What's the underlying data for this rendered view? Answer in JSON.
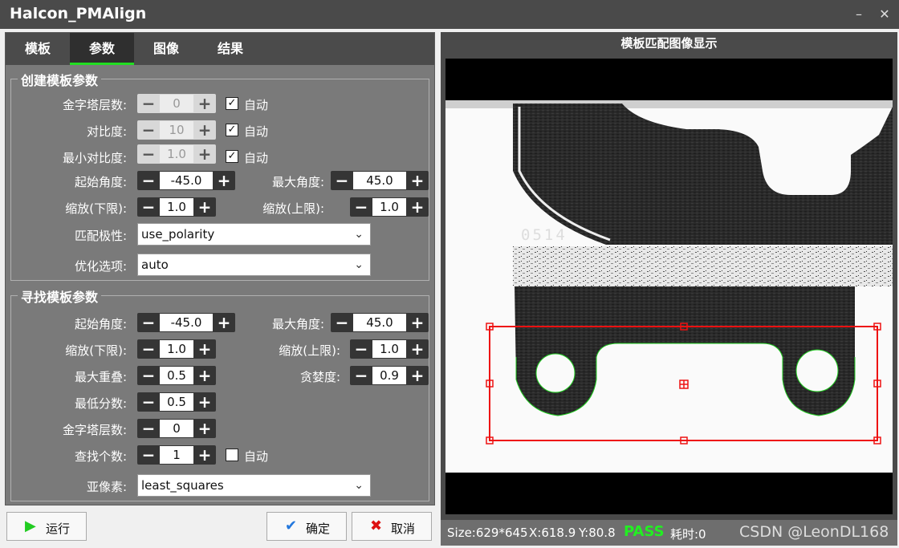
{
  "window": {
    "title": "Halcon_PMAlign",
    "minimize": "–",
    "close": "✕"
  },
  "tabs": [
    {
      "label": "模板",
      "active": false
    },
    {
      "label": "参数",
      "active": true
    },
    {
      "label": "图像",
      "active": false
    },
    {
      "label": "结果",
      "active": false
    }
  ],
  "create_group": {
    "title": "创建模板参数",
    "pyramid": {
      "label": "金字塔层数:",
      "value": "0",
      "auto_label": "自动",
      "auto": true
    },
    "contrast": {
      "label": "对比度:",
      "value": "10",
      "auto_label": "自动",
      "auto": true
    },
    "min_contrast": {
      "label": "最小对比度:",
      "value": "1.0",
      "auto_label": "自动",
      "auto": true
    },
    "start_angle": {
      "label": "起始角度:",
      "value": "-45.0"
    },
    "max_angle": {
      "label": "最大角度:",
      "value": "45.0"
    },
    "scale_min": {
      "label": "缩放(下限):",
      "value": "1.0"
    },
    "scale_max": {
      "label": "缩放(上限):",
      "value": "1.0"
    },
    "polarity": {
      "label": "匹配极性:",
      "value": "use_polarity"
    },
    "optimization": {
      "label": "优化选项:",
      "value": "auto"
    }
  },
  "find_group": {
    "title": "寻找模板参数",
    "start_angle": {
      "label": "起始角度:",
      "value": "-45.0"
    },
    "max_angle": {
      "label": "最大角度:",
      "value": "45.0"
    },
    "scale_min": {
      "label": "缩放(下限):",
      "value": "1.0"
    },
    "scale_max": {
      "label": "缩放(上限):",
      "value": "1.0"
    },
    "max_overlap": {
      "label": "最大重叠:",
      "value": "0.5"
    },
    "greediness": {
      "label": "贪婪度:",
      "value": "0.9"
    },
    "min_score": {
      "label": "最低分数:",
      "value": "0.5"
    },
    "pyramid": {
      "label": "金字塔层数:",
      "value": "0"
    },
    "num_matches": {
      "label": "查找个数:",
      "value": "1",
      "auto_label": "自动",
      "auto": false
    },
    "subpixel": {
      "label": "亚像素:",
      "value": "least_squares"
    }
  },
  "buttons": {
    "run": "运行",
    "ok": "确定",
    "cancel": "取消"
  },
  "viewer": {
    "title": "模板匹配图像显示",
    "part_marking": "0514",
    "status": {
      "size": "Size:629*645",
      "x": "X:618.9",
      "y": "Y:80.8",
      "result": "PASS",
      "time": "耗时:0",
      "watermark": "CSDN @LeonDL168"
    }
  },
  "colors": {
    "accent": "#22dd22",
    "roi": "#ee1111",
    "contour": "#22cc22",
    "pass": "#22ee22"
  },
  "icons": {
    "run": "play-icon",
    "ok": "check-icon",
    "cancel": "x-icon"
  }
}
